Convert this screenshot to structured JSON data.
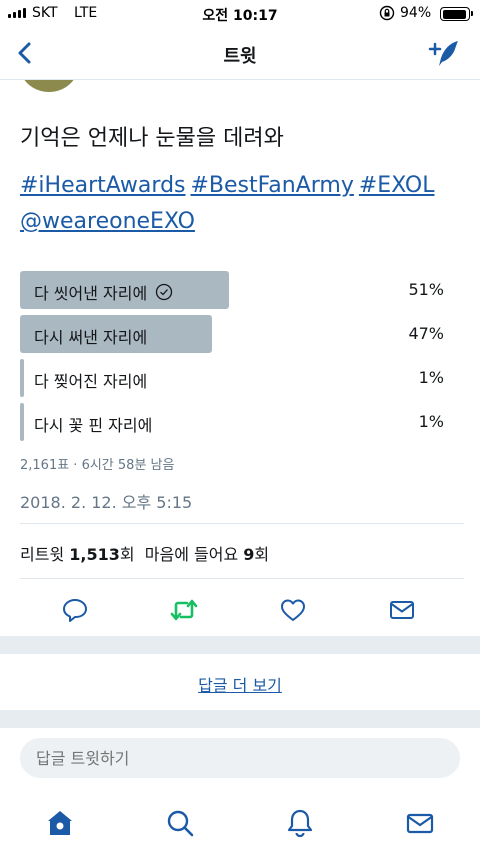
{
  "status_bar": {
    "carrier": "SKT",
    "network": "LTE",
    "time": "오전 10:17",
    "battery_percent": "94%",
    "battery_level": 0.94
  },
  "nav": {
    "title": "트윗",
    "back_icon": "chevron-left-icon",
    "compose_icon": "compose-tweet-icon"
  },
  "tweet": {
    "text": "기억은 언제나 눈물을 데려와",
    "hashtags": [
      "#iHeartAwards",
      "#BestFanArmy",
      "#EXOL"
    ],
    "mention": "@weareoneEXO"
  },
  "poll": {
    "options": [
      {
        "label": "다 씻어낸 자리에",
        "percent": "51%",
        "value": 51,
        "selected": true
      },
      {
        "label": "다시 써낸 자리에",
        "percent": "47%",
        "value": 47,
        "selected": false
      },
      {
        "label": "다 찢어진 자리에",
        "percent": "1%",
        "value": 1,
        "selected": false
      },
      {
        "label": "다시 꽃 핀 자리에",
        "percent": "1%",
        "value": 1,
        "selected": false
      }
    ],
    "meta": "2,161표 · 6시간 58분 남음"
  },
  "timestamp": "2018. 2. 12. 오후 5:15",
  "stats": {
    "retweet_label": "리트윗",
    "retweet_count": "1,513",
    "retweet_unit": "회",
    "like_label": "마음에 들어요",
    "like_count": "9",
    "like_unit": "회"
  },
  "actions": {
    "reply_icon": "reply-icon",
    "retweet_icon": "retweet-icon",
    "like_icon": "heart-icon",
    "dm_icon": "mail-icon"
  },
  "more_replies": "답글 더 보기",
  "reply_placeholder": "답글 트윗하기",
  "colors": {
    "link": "#1b5aa6",
    "poll_bar": "#aab8c2",
    "retweet_green": "#17bf63",
    "divider": "#e1e8ed",
    "band": "#e6ecf0",
    "text_secondary": "#657786"
  }
}
